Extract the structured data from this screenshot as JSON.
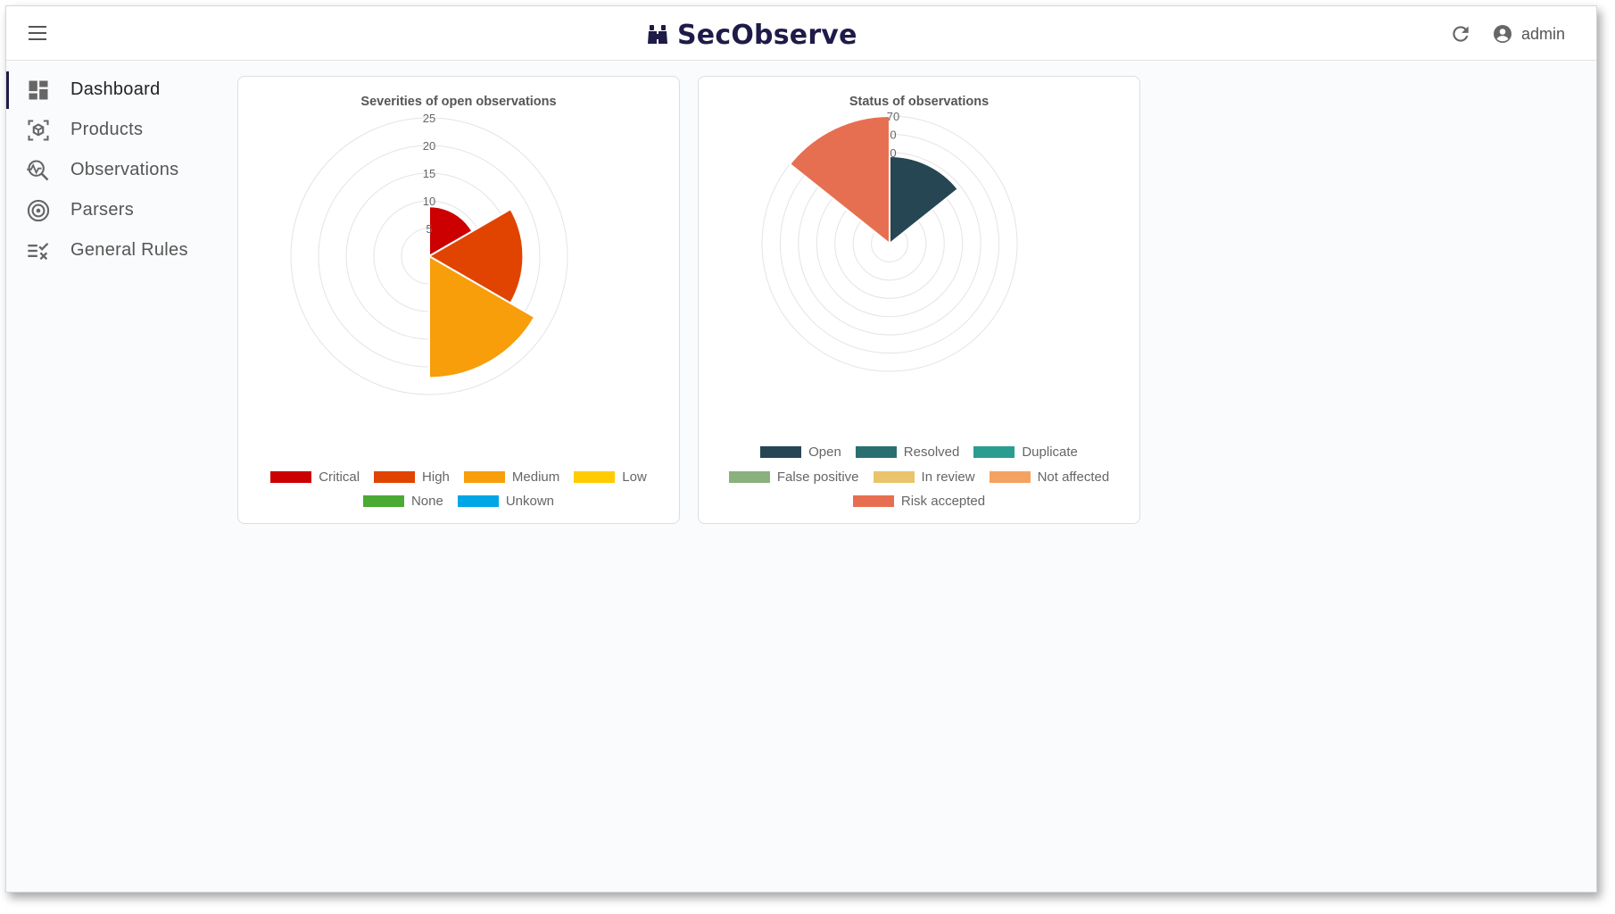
{
  "app": {
    "name": "SecObserve"
  },
  "header": {
    "user": "admin",
    "icons": [
      "menu-icon",
      "refresh-icon",
      "account-icon"
    ]
  },
  "sidebar": {
    "items": [
      {
        "label": "Dashboard",
        "icon": "dashboard-icon",
        "active": true
      },
      {
        "label": "Products",
        "icon": "product-cube-icon"
      },
      {
        "label": "Observations",
        "icon": "observation-search-icon"
      },
      {
        "label": "Parsers",
        "icon": "parser-target-icon"
      },
      {
        "label": "General Rules",
        "icon": "rules-icon"
      }
    ]
  },
  "chart_data": [
    {
      "type": "polar-area",
      "title": "Severities of open observations",
      "categories": [
        "Critical",
        "High",
        "Medium",
        "Low",
        "None",
        "Unkown"
      ],
      "values": [
        9,
        17,
        22,
        0,
        0,
        0
      ],
      "colors": [
        "#cc0000",
        "#e04400",
        "#f79e0a",
        "#ffcc00",
        "#4aaa33",
        "#00a6e6"
      ],
      "r_ticks": [
        "5",
        "10",
        "15",
        "20",
        "25"
      ],
      "rlim": [
        0,
        25
      ],
      "legend_position": "bottom"
    },
    {
      "type": "polar-area",
      "title": "Status of observations",
      "categories": [
        "Open",
        "Resolved",
        "Duplicate",
        "False positive",
        "In review",
        "Not affected",
        "Risk accepted"
      ],
      "values": [
        48,
        0,
        0,
        0,
        0,
        0,
        70
      ],
      "colors": [
        "#264653",
        "#2a6f6f",
        "#2a9d8f",
        "#8ab17d",
        "#e9c46a",
        "#f4a261",
        "#e76f51"
      ],
      "r_ticks": [
        "0",
        "0",
        "70"
      ],
      "rlim": [
        0,
        70
      ],
      "legend_position": "bottom"
    }
  ]
}
